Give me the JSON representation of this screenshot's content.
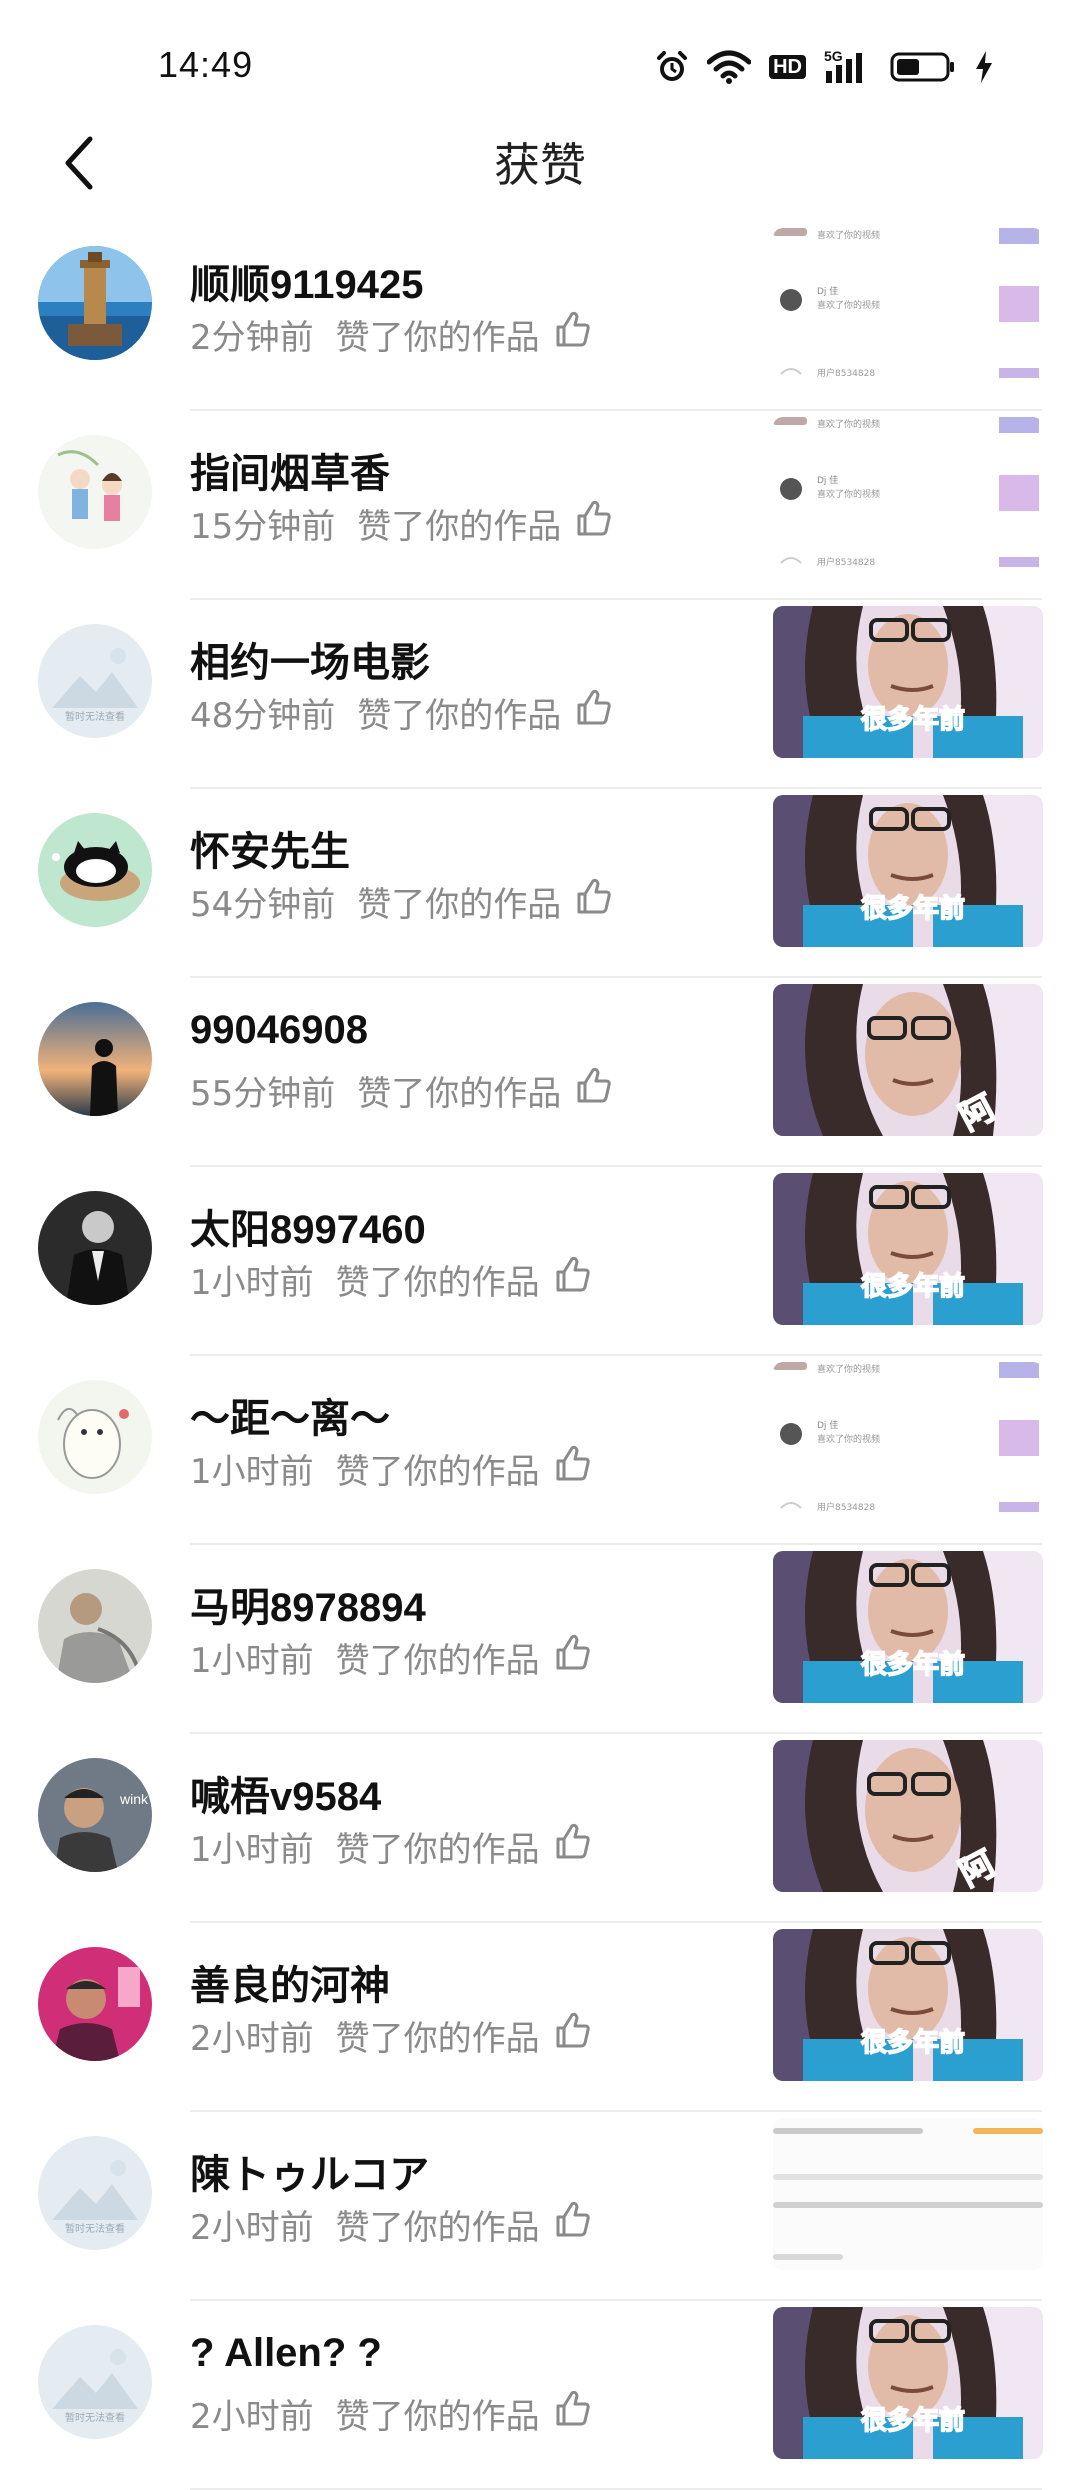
{
  "status_bar": {
    "time": "14:49",
    "icons": [
      "alarm-icon",
      "wifi-icon",
      "hd-badge",
      "signal-5g-icon",
      "battery-icon",
      "charging-icon"
    ],
    "hd_label": "HD",
    "network_label": "5G"
  },
  "header": {
    "title": "获赞",
    "back_icon": "chevron-left-icon"
  },
  "likes": [
    {
      "name": "顺顺9119425",
      "time": "2分钟前",
      "action": "赞了你的作品",
      "avatar": "lighthouse",
      "thumb": "chat-screenshot"
    },
    {
      "name": "指间烟草香",
      "time": "15分钟前",
      "action": "赞了你的作品",
      "avatar": "anime-couple",
      "thumb": "chat-screenshot"
    },
    {
      "name": "相约一场电影",
      "time": "48分钟前",
      "action": "赞了你的作品",
      "avatar": "placeholder",
      "thumb": "video-portrait-caption"
    },
    {
      "name": "怀安先生",
      "time": "54分钟前",
      "action": "赞了你的作品",
      "avatar": "cartoon-cat",
      "thumb": "video-portrait-caption"
    },
    {
      "name": "99046908",
      "time": "55分钟前",
      "action": "赞了你的作品",
      "avatar": "silhouette-sunset",
      "thumb": "video-portrait-closeup"
    },
    {
      "name": "太阳8997460",
      "time": "1小时前",
      "action": "赞了你的作品",
      "avatar": "man-in-suit",
      "thumb": "video-portrait-caption"
    },
    {
      "name": "～距～离～",
      "time": "1小时前",
      "action": "赞了你的作品",
      "avatar": "cartoon-drawing",
      "thumb": "chat-screenshot"
    },
    {
      "name": "马明8978894",
      "time": "1小时前",
      "action": "赞了你的作品",
      "avatar": "man-grey",
      "thumb": "video-portrait-caption"
    },
    {
      "name": "喊梧v9584",
      "time": "1小时前",
      "action": "赞了你的作品",
      "avatar": "man-wink",
      "thumb": "video-portrait-closeup"
    },
    {
      "name": "善良的河神",
      "time": "2小时前",
      "action": "赞了你的作品",
      "avatar": "man-pink",
      "thumb": "video-portrait-caption"
    },
    {
      "name": "陳トゥルコア",
      "time": "2小时前",
      "action": "赞了你的作品",
      "avatar": "placeholder",
      "thumb": "blurred-text"
    },
    {
      "name": "? Allen? ?",
      "time": "2小时前",
      "action": "赞了你的作品",
      "avatar": "placeholder",
      "thumb": "video-portrait-caption"
    }
  ],
  "thumb_captions": {
    "video-portrait-caption": "很多年前",
    "video-portrait-closeup": "阿"
  },
  "thumb_chat_lines": {
    "line1": "喜欢了你的视频",
    "line2": "Dj 佳",
    "line3": "用户8534828"
  },
  "avatar_placeholder_text": "暂时无法查看",
  "avatar_wink_text": "wink",
  "colors": {
    "primary_text": "#111111",
    "secondary_text": "#8a8a8a",
    "divider": "#ececec",
    "background": "#ffffff",
    "caption_red": "#e8344a"
  }
}
